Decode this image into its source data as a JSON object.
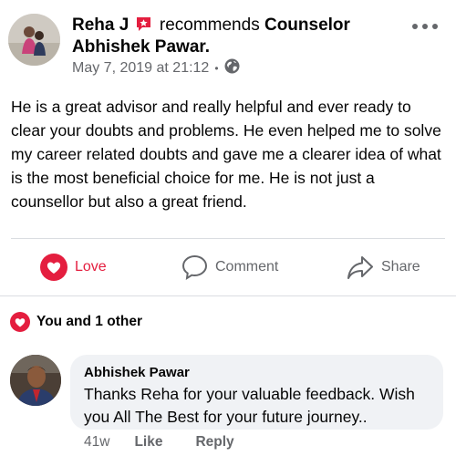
{
  "post": {
    "author": "Reha J",
    "action_text": "recommends",
    "recommended_page": "Counselor Abhishek Pawar.",
    "timestamp": "May 7, 2019 at 21:12",
    "separator": "•",
    "audience_icon": "globe-icon",
    "badge_icon": "recommendation-badge-icon",
    "body": "He is a great advisor and really helpful and ever ready to clear your doubts and problems. He even helped me to solve my career related doubts and gave me a clearer idea of what is the most beneficial choice for me. He is not just a counsellor but also a great friend."
  },
  "actions": {
    "love_label": "Love",
    "comment_label": "Comment",
    "share_label": "Share"
  },
  "reactions": {
    "summary": "You and 1 other",
    "icon": "love-reaction-icon"
  },
  "comment": {
    "author": "Abhishek Pawar",
    "text": "Thanks Reha for your valuable feedback. Wish you All The Best for your future journey..",
    "time": "41w",
    "like_label": "Like",
    "reply_label": "Reply"
  },
  "colors": {
    "love_red": "#e41e3f",
    "secondary_text": "#65676b",
    "bubble_bg": "#f0f2f5"
  }
}
